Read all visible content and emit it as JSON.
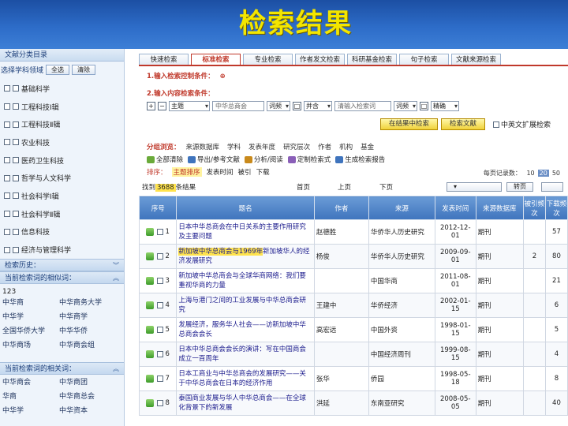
{
  "slide_title": "检索结果",
  "left_panel": {
    "header": "文献分类目录",
    "subject_label": "选择学科领域",
    "btn_all": "全选",
    "btn_clear": "清除",
    "categories": [
      "基础科学",
      "工程科技Ⅰ辑",
      "工程科技Ⅱ辑",
      "农业科技",
      "医药卫生科技",
      "哲学与人文科学",
      "社会科学Ⅰ辑",
      "社会科学Ⅱ辑",
      "信息科技",
      "经济与管理科学"
    ],
    "history_title": "检索历史：",
    "related_title": "当前检索词的相似词：",
    "related_first": "123",
    "related_words": [
      "中华商",
      "中华商务大学",
      "中华学",
      "中华商学",
      "全国华侨大学",
      "中华华侨",
      "中华商场",
      "中华商会组"
    ],
    "assoc_title": "当前检索词的相关词：",
    "assoc_words": [
      "中华商会",
      "中华商团",
      "华商",
      "中华商总会",
      "中华学",
      "中华资本"
    ]
  },
  "tabs": [
    "快速检索",
    "标准检索",
    "专业检索",
    "作者发文检索",
    "科研基金检索",
    "句子检索",
    "文献来源检索"
  ],
  "active_tab": 1,
  "cond1_label": "1.输入检索控制条件：",
  "cond2_label": "2.输入内容检索条件：",
  "field_select": "主题",
  "field_input": "中华总商会",
  "match1": "词频",
  "op": "并含",
  "word2_placeholder": "清输入检索词",
  "match2": "词频",
  "exact": "精确",
  "btn_search_in": "在结果中检索",
  "btn_search": "检索文献",
  "cross_lang": "中英文扩展检索",
  "group_label": "分组浏览：",
  "groups": [
    "来源数据库",
    "学科",
    "发表年度",
    "研究层次",
    "作者",
    "机构",
    "基金"
  ],
  "tools": [
    "全部清除",
    "导出/参考文献",
    "分析/阅读",
    "定制检索式",
    "生成检索报告"
  ],
  "sort_label": "排序：",
  "sorts": [
    "主题排序",
    "发表时间",
    "被引",
    "下载"
  ],
  "active_sort": 0,
  "per_page_label": "每页记录数：",
  "per_page": [
    "10",
    "20",
    "50"
  ],
  "active_per_page": 1,
  "found_prefix": "找到",
  "found_num": "3688",
  "found_suffix": "条结果",
  "page_first": "首页",
  "page_prev": "上页",
  "page_next": "下页",
  "jump_label": "转页",
  "table_head": [
    "序号",
    "题名",
    "作者",
    "来源",
    "发表时间",
    "来源数据库",
    "被引频次",
    "下载频次"
  ],
  "rows": [
    {
      "n": "1",
      "pre": "日本中华总商会",
      "hl": "",
      "post": "在中日关系的主要作用研究及主要问题",
      "author": "赵德胜",
      "source": "华侨华人历史研究",
      "date": "2012-12-01",
      "db": "期刊",
      "cite": "",
      "dl": "57"
    },
    {
      "n": "2",
      "pre": "",
      "hl": "新加坡中华总商会与1969年",
      "post": "新加坡华人的经济发展研究",
      "author": "杨俊",
      "source": "华侨华人历史研究",
      "date": "2009-09-01",
      "db": "期刊",
      "cite": "2",
      "dl": "80"
    },
    {
      "n": "3",
      "pre": "新加坡中华总商会与全球华商网络：我们要重视华商的力量",
      "hl": "",
      "post": "",
      "author": "",
      "source": "中国华商",
      "date": "2011-08-01",
      "db": "期刊",
      "cite": "",
      "dl": "21"
    },
    {
      "n": "4",
      "pre": "上海与港门之间的工业发展与中华总商会研究",
      "hl": "",
      "post": "",
      "author": "王建中",
      "source": "华侨经济",
      "date": "2002-01-15",
      "db": "期刊",
      "cite": "",
      "dl": "6"
    },
    {
      "n": "5",
      "pre": "发展经济，服务华人社会——访新加坡中华总商会会长",
      "hl": "",
      "post": "",
      "author": "高宏远",
      "source": "中国外资",
      "date": "1998-01-15",
      "db": "期刊",
      "cite": "",
      "dl": "5"
    },
    {
      "n": "6",
      "pre": "日本中华总商会会长的演讲：写在中国商会成立一百周年",
      "hl": "",
      "post": "",
      "author": "",
      "source": "中国经济周刊",
      "date": "1999-08-15",
      "db": "期刊",
      "cite": "",
      "dl": "4"
    },
    {
      "n": "7",
      "pre": "日本工商业与中华总商会的发展研究——关于中华总商会在日本的经济作用",
      "hl": "",
      "post": "",
      "author": "张华",
      "source": "侨园",
      "date": "1998-05-18",
      "db": "期刊",
      "cite": "",
      "dl": "8"
    },
    {
      "n": "8",
      "pre": "泰国商业发展与华人中华总商会——在全球化背景下的新发展",
      "hl": "",
      "post": "",
      "author": "洪延",
      "source": "东南亚研究",
      "date": "2008-05-05",
      "db": "期刊",
      "cite": "",
      "dl": "40"
    }
  ]
}
